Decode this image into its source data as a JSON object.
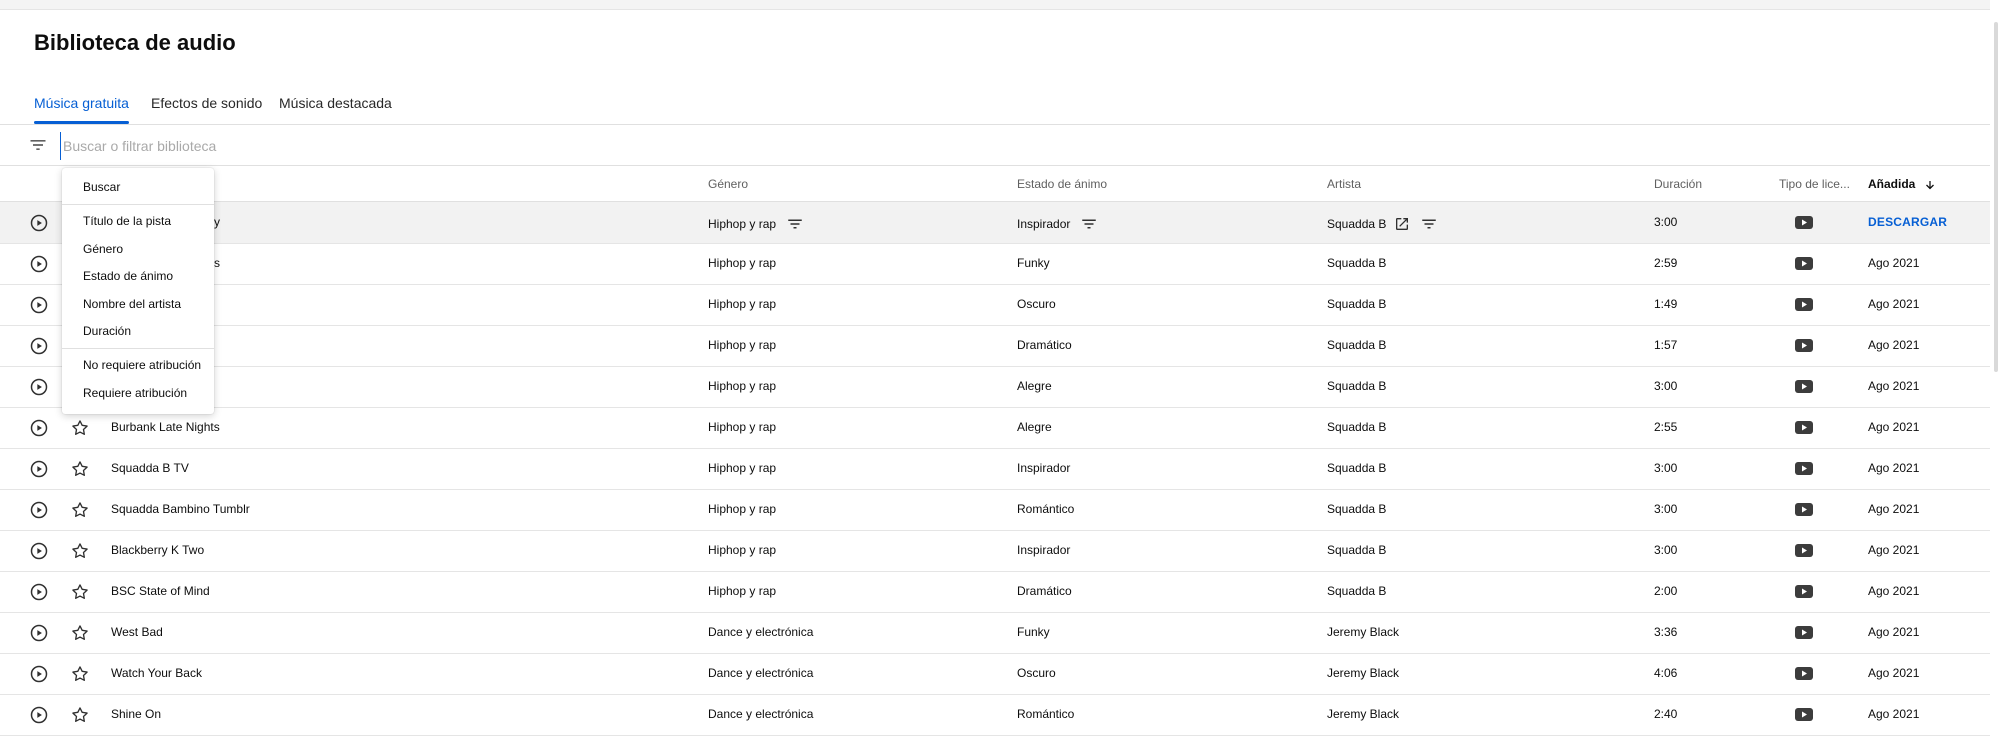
{
  "page": {
    "title": "Biblioteca de audio"
  },
  "tabs": [
    {
      "label": "Música gratuita",
      "active": true
    },
    {
      "label": "Efectos de sonido",
      "active": false
    },
    {
      "label": "Música destacada",
      "active": false
    }
  ],
  "search": {
    "placeholder": "Buscar o filtrar biblioteca",
    "value": ""
  },
  "table": {
    "headers": {
      "genre": "Género",
      "mood": "Estado de ánimo",
      "artist": "Artista",
      "duration": "Duración",
      "license": "Tipo de lice...",
      "added": "Añadida"
    },
    "sort": {
      "column": "added",
      "direction": "descending"
    },
    "download_label": "DESCARGAR",
    "rows": [
      {
        "title": "y",
        "genre": "Hiphop y rap",
        "mood": "Inspirador",
        "artist": "Squadda B",
        "duration": "3:00",
        "added": ""
      },
      {
        "title": "s",
        "genre": "Hiphop y rap",
        "mood": "Funky",
        "artist": "Squadda B",
        "duration": "2:59",
        "added": "Ago 2021"
      },
      {
        "title": "",
        "genre": "Hiphop y rap",
        "mood": "Oscuro",
        "artist": "Squadda B",
        "duration": "1:49",
        "added": "Ago 2021"
      },
      {
        "title": "",
        "genre": "Hiphop y rap",
        "mood": "Dramático",
        "artist": "Squadda B",
        "duration": "1:57",
        "added": "Ago 2021"
      },
      {
        "title": "",
        "genre": "Hiphop y rap",
        "mood": "Alegre",
        "artist": "Squadda B",
        "duration": "3:00",
        "added": "Ago 2021"
      },
      {
        "title": "Burbank Late Nights",
        "genre": "Hiphop y rap",
        "mood": "Alegre",
        "artist": "Squadda B",
        "duration": "2:55",
        "added": "Ago 2021"
      },
      {
        "title": "Squadda B TV",
        "genre": "Hiphop y rap",
        "mood": "Inspirador",
        "artist": "Squadda B",
        "duration": "3:00",
        "added": "Ago 2021"
      },
      {
        "title": "Squadda Bambino Tumblr",
        "genre": "Hiphop y rap",
        "mood": "Romántico",
        "artist": "Squadda B",
        "duration": "3:00",
        "added": "Ago 2021"
      },
      {
        "title": "Blackberry K Two",
        "genre": "Hiphop y rap",
        "mood": "Inspirador",
        "artist": "Squadda B",
        "duration": "3:00",
        "added": "Ago 2021"
      },
      {
        "title": "BSC State of Mind",
        "genre": "Hiphop y rap",
        "mood": "Dramático",
        "artist": "Squadda B",
        "duration": "2:00",
        "added": "Ago 2021"
      },
      {
        "title": "West Bad",
        "genre": "Dance y electrónica",
        "mood": "Funky",
        "artist": "Jeremy Black",
        "duration": "3:36",
        "added": "Ago 2021"
      },
      {
        "title": "Watch Your Back",
        "genre": "Dance y electrónica",
        "mood": "Oscuro",
        "artist": "Jeremy Black",
        "duration": "4:06",
        "added": "Ago 2021"
      },
      {
        "title": "Shine On",
        "genre": "Dance y electrónica",
        "mood": "Romántico",
        "artist": "Jeremy Black",
        "duration": "2:40",
        "added": "Ago 2021"
      }
    ]
  },
  "filter_menu": {
    "items": [
      "Buscar",
      "Título de la pista",
      "Género",
      "Estado de ánimo",
      "Nombre del artista",
      "Duración",
      "No requiere atribución",
      "Requiere atribución"
    ]
  },
  "colors": {
    "accent": "#065fd4",
    "text": "#0d0d0d",
    "muted": "#606060",
    "divider": "#e0e0e0",
    "hover_row": "#f2f2f2"
  },
  "icons": {
    "filter": "filter-icon",
    "play": "play-circle-icon",
    "star": "star-outline-icon",
    "license": "youtube-icon",
    "open": "open-in-new-icon",
    "sort": "arrow-down-icon"
  }
}
